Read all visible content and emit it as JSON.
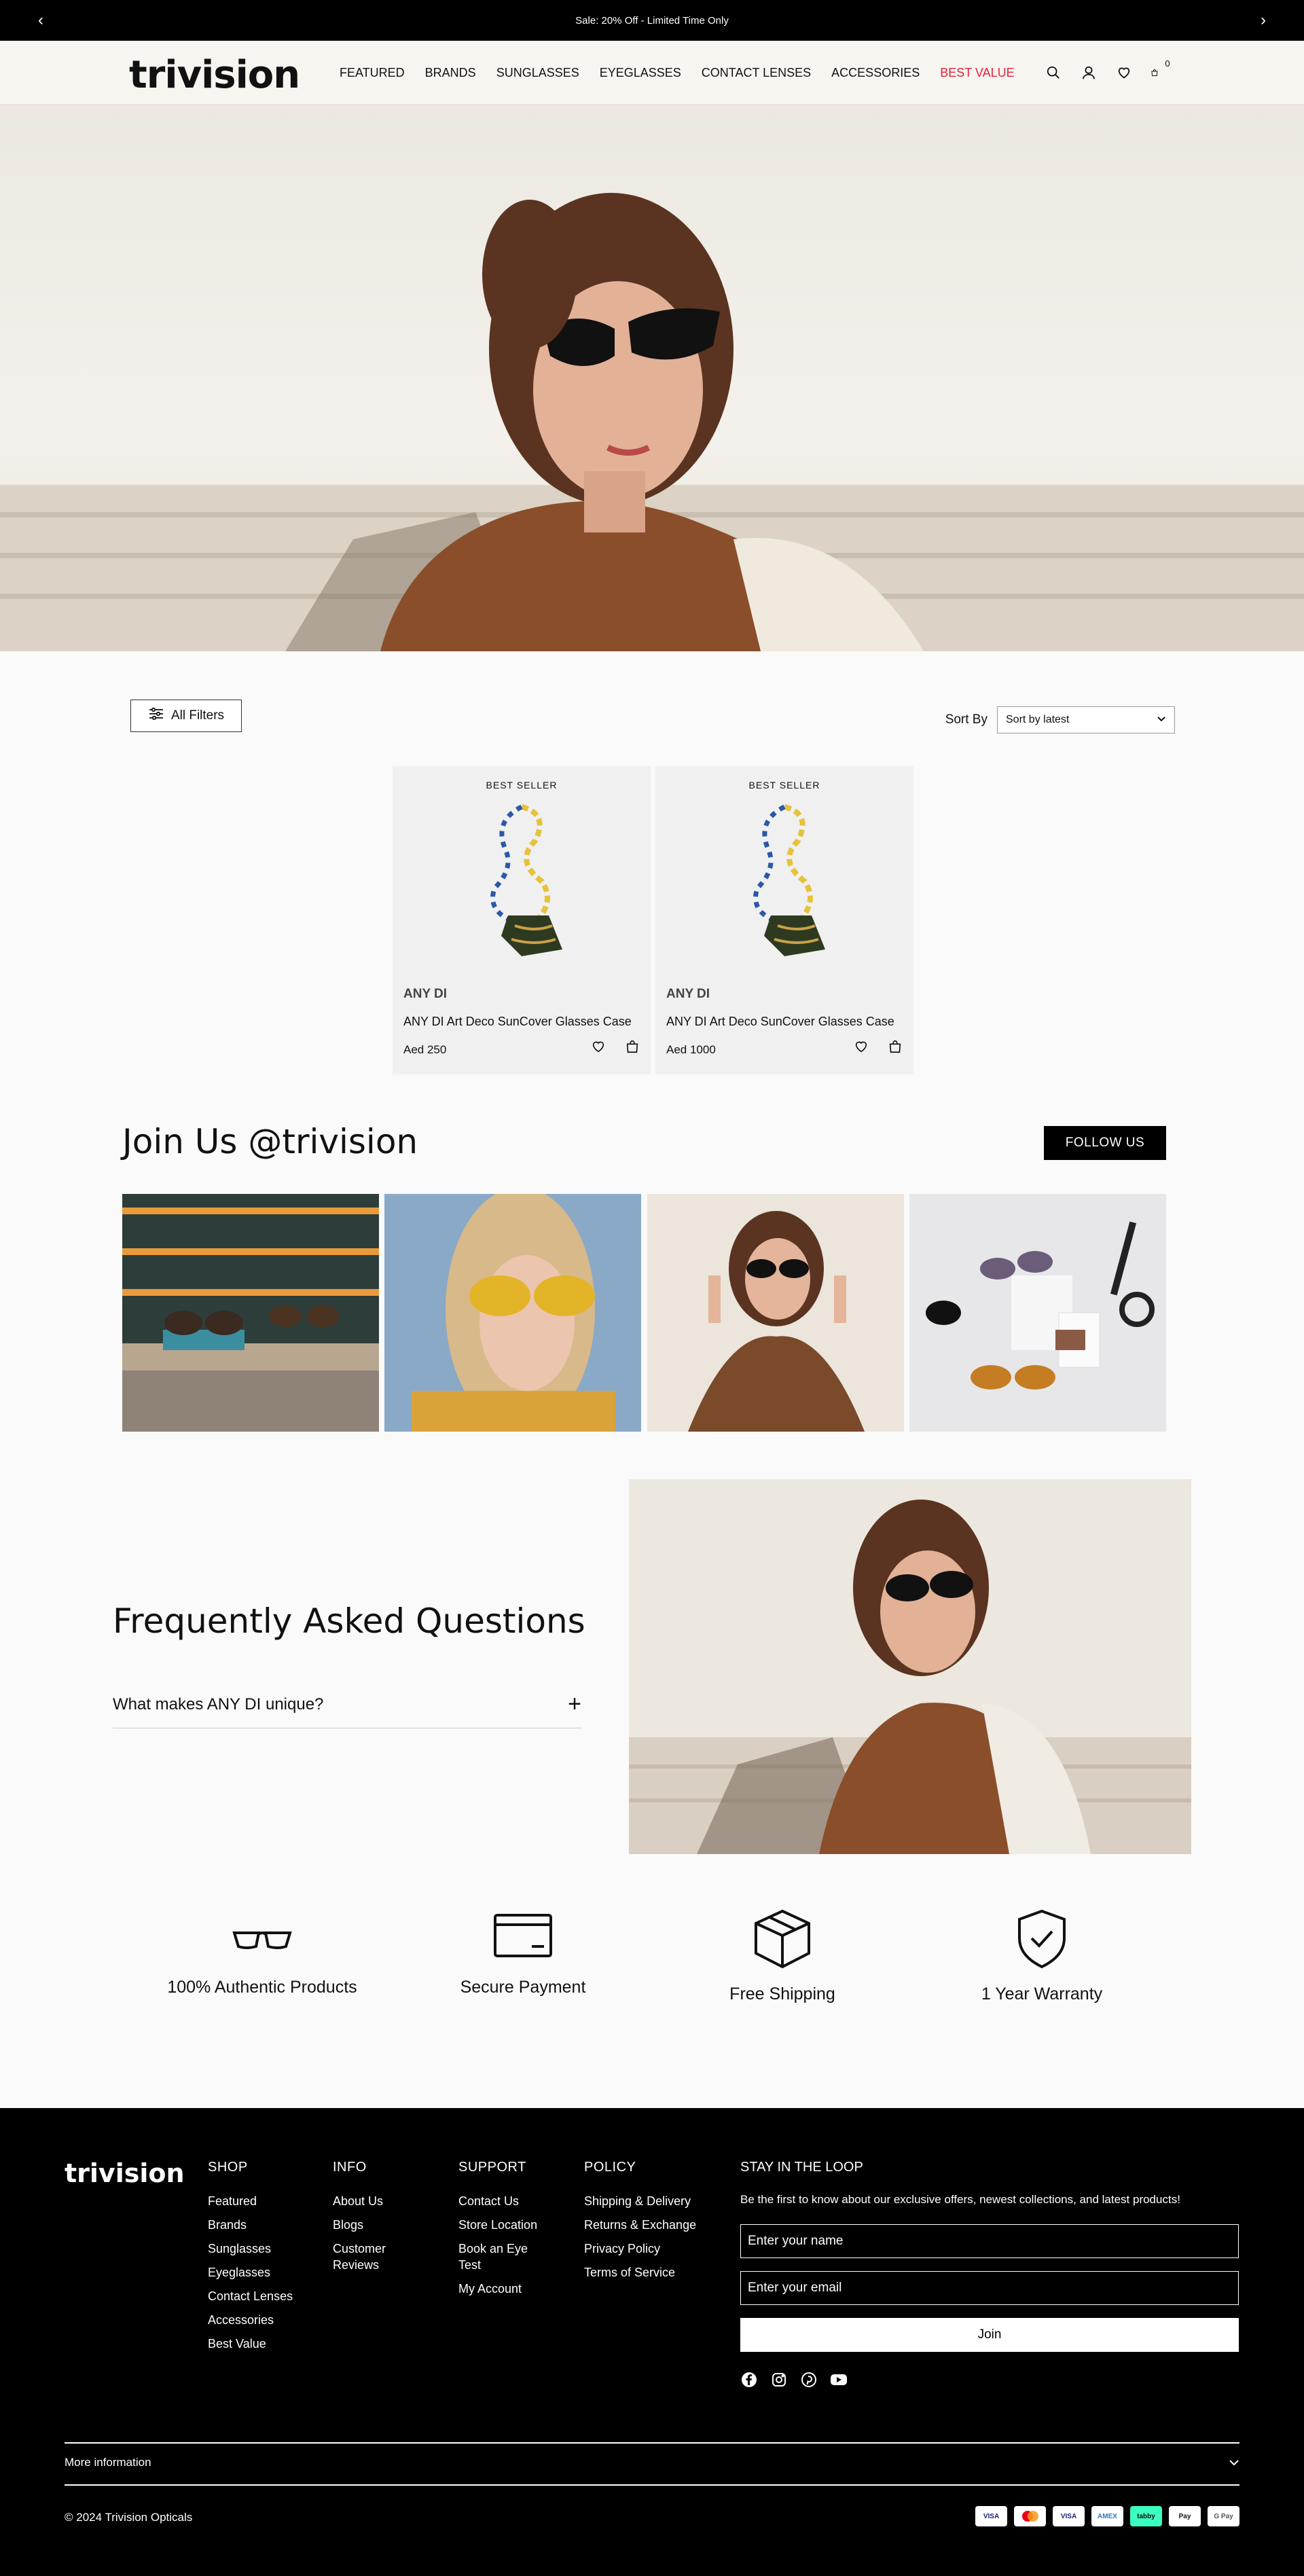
{
  "announcement": {
    "text": "Sale: 20% Off - Limited Time Only",
    "prev": "‹",
    "next": "›"
  },
  "header": {
    "logo": "trivision",
    "nav": [
      {
        "label": "FEATURED"
      },
      {
        "label": "BRANDS"
      },
      {
        "label": "SUNGLASSES"
      },
      {
        "label": "EYEGLASSES"
      },
      {
        "label": "CONTACT LENSES"
      },
      {
        "label": "ACCESSORIES"
      },
      {
        "label": "BEST VALUE",
        "highlight": true
      }
    ],
    "cart_count": "0",
    "icons": [
      "search-icon",
      "user-icon",
      "heart-icon",
      "cart-icon"
    ],
    "accent_color": "#e0243a"
  },
  "toolbar": {
    "filters_label": "All Filters",
    "sort_label": "Sort By",
    "sort_value": "Sort by latest"
  },
  "products": [
    {
      "badge": "BEST SELLER",
      "brand": "ANY DI",
      "name": "ANY DI Art Deco SunCover Glasses Case",
      "price": "Aed 250"
    },
    {
      "badge": "BEST SELLER",
      "brand": "ANY DI",
      "name": "ANY DI Art Deco SunCover Glasses Case",
      "price": "Aed 1000"
    }
  ],
  "join": {
    "title": "Join Us @trivision",
    "follow_label": "FOLLOW US"
  },
  "faq": {
    "title": "Frequently Asked Questions",
    "items": [
      {
        "question": "What makes ANY DI unique?",
        "toggle": "+"
      }
    ]
  },
  "features": [
    {
      "label": "100% Authentic Products",
      "icon": "glasses-icon"
    },
    {
      "label": "Secure Payment",
      "icon": "card-icon"
    },
    {
      "label": "Free Shipping",
      "icon": "box-icon"
    },
    {
      "label": "1 Year Warranty",
      "icon": "shield-check-icon"
    }
  ],
  "footer": {
    "logo": "trivision",
    "shop": {
      "title": "SHOP",
      "links": [
        "Featured",
        "Brands",
        "Sunglasses",
        "Eyeglasses",
        "Contact Lenses",
        "Accessories",
        "Best Value"
      ]
    },
    "info": {
      "title": "INFO",
      "links": [
        "About Us",
        "Blogs",
        "Customer Reviews"
      ]
    },
    "support": {
      "title": "SUPPORT",
      "links": [
        "Contact Us",
        "Store Location",
        "Book an Eye Test",
        "My Account"
      ]
    },
    "policy": {
      "title": "POLICY",
      "links": [
        "Shipping & Delivery",
        "Returns & Exchange",
        "Privacy Policy",
        "Terms of Service"
      ]
    },
    "newsletter": {
      "title": "STAY IN THE LOOP",
      "subtitle": "Be the first to know about our exclusive offers, newest collections, and latest products!",
      "name_placeholder": "Enter your name",
      "email_placeholder": "Enter your email",
      "join_label": "Join"
    },
    "social": [
      "facebook-icon",
      "instagram-icon",
      "pinterest-icon",
      "youtube-icon"
    ],
    "more_info": "More information",
    "copyright": "© 2024 Trivision Opticals",
    "payments": [
      "VISA",
      "MC",
      "VISA",
      "AMEX",
      "tabby",
      "Pay",
      "G Pay"
    ]
  }
}
